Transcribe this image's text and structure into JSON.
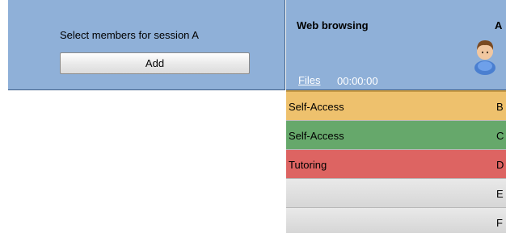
{
  "session_panel": {
    "select_label": "Select members for session  A",
    "add_button": "Add"
  },
  "session_header": {
    "activity": "Web browsing",
    "session_letter": "A",
    "files_link": "Files",
    "timer": "00:00:00",
    "avatar_icon": "user-avatar-icon"
  },
  "sessions": [
    {
      "label": "Self-Access",
      "letter": "B",
      "color": "#eec16d"
    },
    {
      "label": "Self-Access",
      "letter": "C",
      "color": "#66a86b"
    },
    {
      "label": "Tutoring",
      "letter": "D",
      "color": "#dd6462"
    },
    {
      "label": "",
      "letter": "E",
      "color": "#e0e0e0"
    },
    {
      "label": "",
      "letter": "F",
      "color": "#e0e0e0"
    }
  ]
}
